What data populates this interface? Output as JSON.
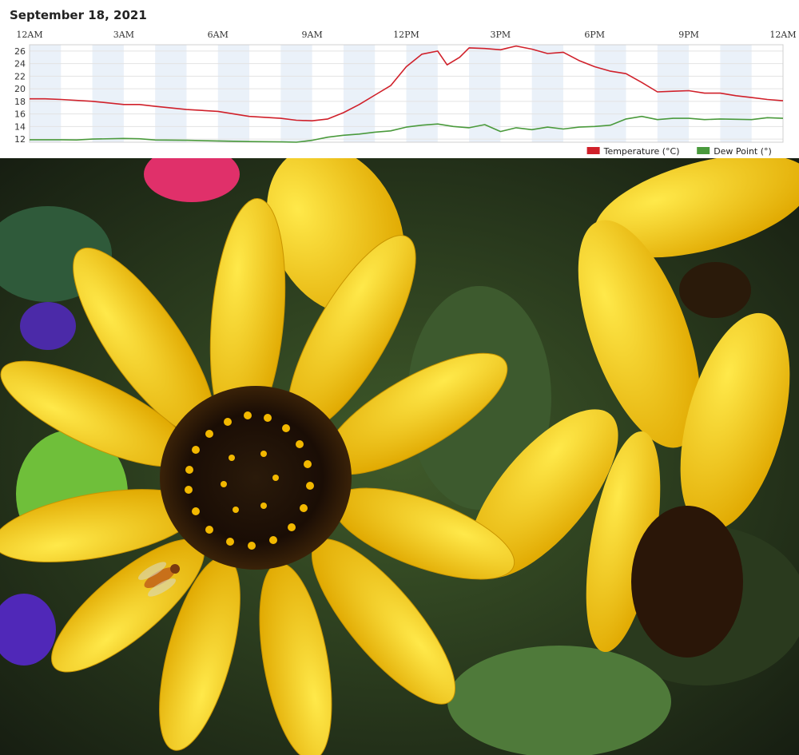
{
  "chart_data": {
    "type": "line",
    "title": "September 18, 2021",
    "x_ticks": [
      "12AM",
      "3AM",
      "6AM",
      "9AM",
      "12PM",
      "3PM",
      "6PM",
      "9PM",
      "12AM"
    ],
    "y_ticks": [
      12,
      14,
      16,
      18,
      20,
      22,
      24,
      26
    ],
    "ylim": [
      11.5,
      27
    ],
    "xlim_hours": [
      0,
      24
    ],
    "grid": true,
    "legend_position": "bottom-right",
    "series": [
      {
        "name": "Temperature (°C)",
        "color": "#d0202a",
        "points": [
          [
            0,
            18.4
          ],
          [
            0.5,
            18.4
          ],
          [
            1,
            18.3
          ],
          [
            2,
            18
          ],
          [
            3,
            17.5
          ],
          [
            3.5,
            17.5
          ],
          [
            4,
            17.2
          ],
          [
            5,
            16.7
          ],
          [
            6,
            16.4
          ],
          [
            6.5,
            16
          ],
          [
            7,
            15.6
          ],
          [
            8,
            15.3
          ],
          [
            8.5,
            15
          ],
          [
            9,
            14.9
          ],
          [
            9.5,
            15.2
          ],
          [
            10,
            16.2
          ],
          [
            10.5,
            17.5
          ],
          [
            11,
            19
          ],
          [
            11.5,
            20.5
          ],
          [
            12,
            23.5
          ],
          [
            12.5,
            25.5
          ],
          [
            13,
            26
          ],
          [
            13.3,
            23.8
          ],
          [
            13.7,
            25
          ],
          [
            14,
            26.5
          ],
          [
            14.5,
            26.4
          ],
          [
            15,
            26.2
          ],
          [
            15.5,
            26.8
          ],
          [
            16,
            26.3
          ],
          [
            16.5,
            25.6
          ],
          [
            17,
            25.8
          ],
          [
            17.5,
            24.5
          ],
          [
            18,
            23.5
          ],
          [
            18.5,
            22.8
          ],
          [
            19,
            22.4
          ],
          [
            19.5,
            21
          ],
          [
            20,
            19.5
          ],
          [
            20.5,
            19.6
          ],
          [
            21,
            19.7
          ],
          [
            21.5,
            19.3
          ],
          [
            22,
            19.3
          ],
          [
            22.5,
            18.9
          ],
          [
            23,
            18.6
          ],
          [
            23.5,
            18.3
          ],
          [
            24,
            18.1
          ]
        ]
      },
      {
        "name": "Dew Point (°)",
        "color": "#4a9a3c",
        "points": [
          [
            0,
            11.9
          ],
          [
            1,
            11.9
          ],
          [
            1.5,
            11.85
          ],
          [
            2,
            12
          ],
          [
            3,
            12.1
          ],
          [
            3.5,
            12.05
          ],
          [
            4,
            11.85
          ],
          [
            5,
            11.8
          ],
          [
            6,
            11.7
          ],
          [
            6.5,
            11.65
          ],
          [
            7,
            11.6
          ],
          [
            8,
            11.55
          ],
          [
            8.5,
            11.5
          ],
          [
            9,
            11.8
          ],
          [
            9.5,
            12.3
          ],
          [
            10,
            12.6
          ],
          [
            10.5,
            12.8
          ],
          [
            11,
            13.1
          ],
          [
            11.5,
            13.3
          ],
          [
            12,
            13.9
          ],
          [
            12.5,
            14.2
          ],
          [
            13,
            14.4
          ],
          [
            13.5,
            14
          ],
          [
            14,
            13.8
          ],
          [
            14.5,
            14.3
          ],
          [
            15,
            13.2
          ],
          [
            15.5,
            13.8
          ],
          [
            16,
            13.5
          ],
          [
            16.5,
            13.9
          ],
          [
            17,
            13.6
          ],
          [
            17.5,
            13.9
          ],
          [
            18,
            14
          ],
          [
            18.5,
            14.2
          ],
          [
            19,
            15.2
          ],
          [
            19.5,
            15.6
          ],
          [
            20,
            15.1
          ],
          [
            20.5,
            15.3
          ],
          [
            21,
            15.3
          ],
          [
            21.5,
            15.1
          ],
          [
            22,
            15.2
          ],
          [
            23,
            15.1
          ],
          [
            23.5,
            15.4
          ],
          [
            24,
            15.3
          ]
        ]
      }
    ]
  },
  "colors": {
    "band": "#eaf1f9",
    "grid": "#e3e3e3",
    "axis": "#d0d0d0",
    "temperature": "#d0202a",
    "dew_point": "#4a9a3c"
  },
  "photo": {
    "subject": "sunflowers-with-hoverfly"
  }
}
